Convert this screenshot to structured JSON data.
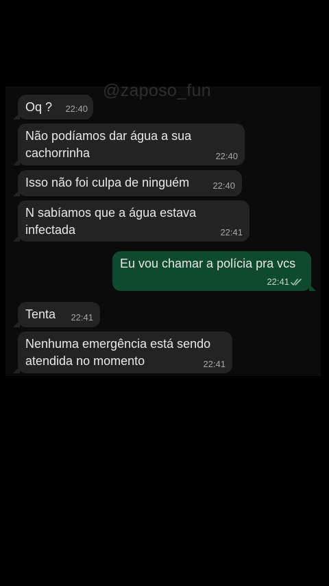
{
  "watermark": "@zaposo_fun",
  "colors": {
    "incoming_bubble": "#232323",
    "outgoing_bubble": "#0f4a2f",
    "background": "#000000"
  },
  "messages": [
    {
      "direction": "incoming",
      "text": "Oq ?",
      "time": "22:40"
    },
    {
      "direction": "incoming",
      "text": "Não podíamos dar água a sua\ncachorrinha",
      "time": "22:40"
    },
    {
      "direction": "incoming",
      "text": "Isso não foi culpa de ninguém",
      "time": "22:40"
    },
    {
      "direction": "incoming",
      "text": "N sabíamos que a água estava\ninfectada",
      "time": "22:41"
    },
    {
      "direction": "outgoing",
      "text": "Eu vou chamar a polícia pra vcs",
      "time": "22:41",
      "status_icon": "double-check-read-icon"
    },
    {
      "direction": "incoming",
      "text": "Tenta",
      "time": "22:41"
    },
    {
      "direction": "incoming",
      "text": "Nenhuma emergência está sendo\natendida no momento",
      "time": "22:41"
    }
  ]
}
